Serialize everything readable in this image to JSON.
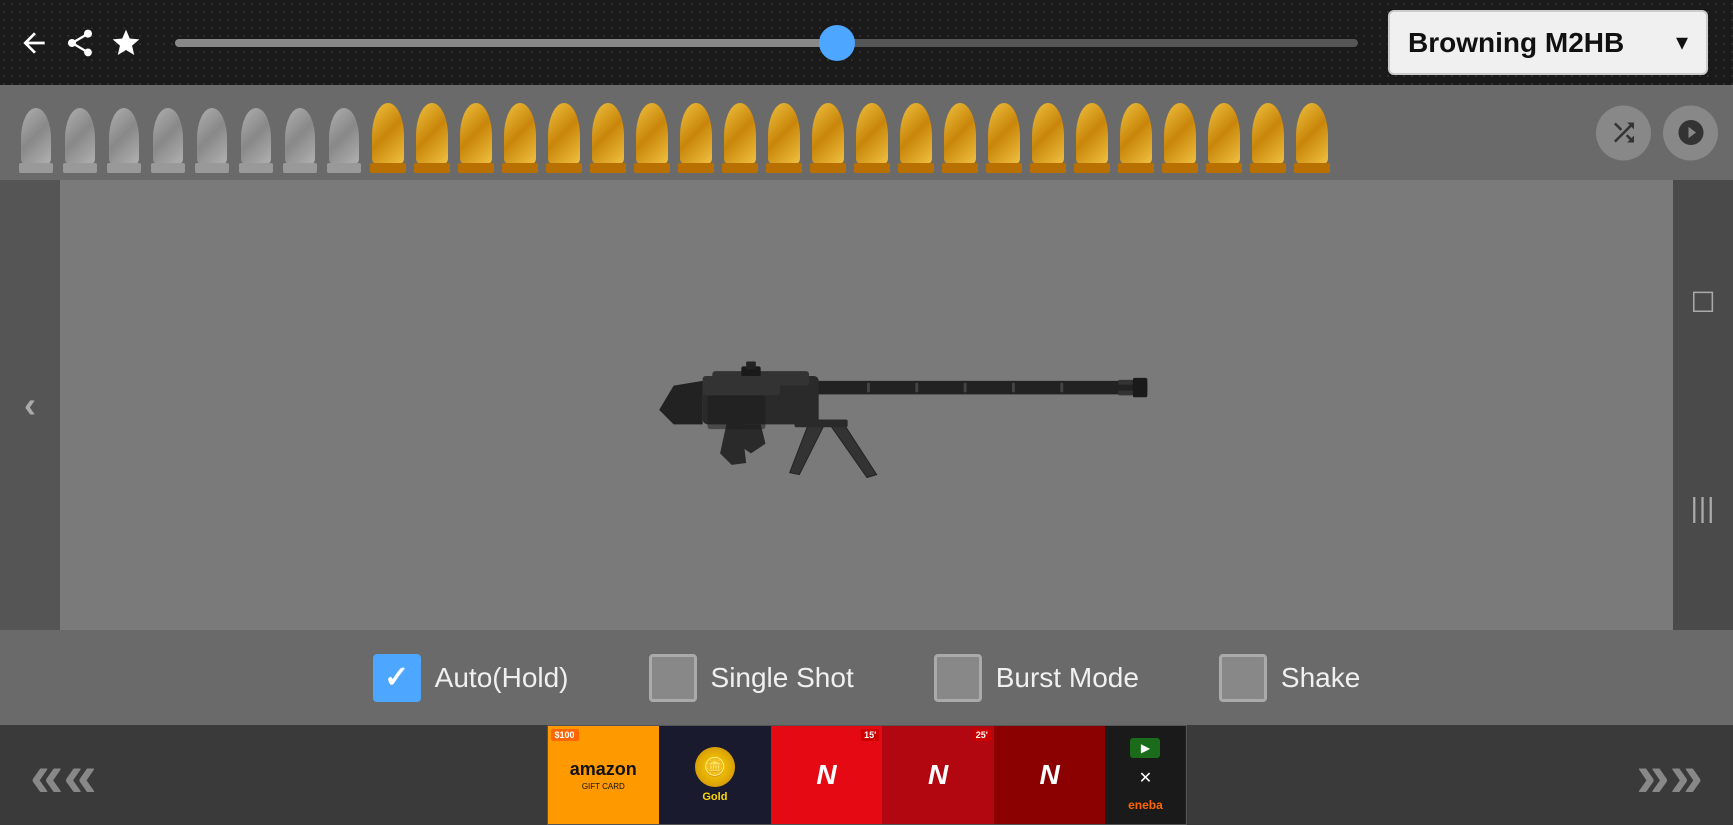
{
  "header": {
    "weapon_name": "Browning M2HB",
    "dropdown_arrow": "▾"
  },
  "navigation": {
    "back_label": "←",
    "share_label": "⎘",
    "favorite_label": "★"
  },
  "bullets": {
    "gray_count": 8,
    "gold_count": 22,
    "shuffle_label": "shuffle",
    "down_label": "down"
  },
  "controls": {
    "auto_hold": {
      "label": "Auto(Hold)",
      "checked": true
    },
    "single_shot": {
      "label": "Single Shot",
      "checked": false
    },
    "burst_mode": {
      "label": "Burst Mode",
      "checked": false
    },
    "shake": {
      "label": "Shake",
      "checked": false
    }
  },
  "bottom_nav": {
    "left_chevrons": "«",
    "right_chevrons": "»"
  },
  "side_nav": {
    "left_arrow": "‹",
    "right_icons": [
      "☐",
      "|||"
    ]
  },
  "ad": {
    "items": [
      "Amazon",
      "Gold",
      "Netflix",
      "Netflix",
      "Netflix"
    ],
    "close": "✕",
    "play": "▶",
    "eneba": "eneba"
  },
  "progress": {
    "fill_percent": 56
  }
}
